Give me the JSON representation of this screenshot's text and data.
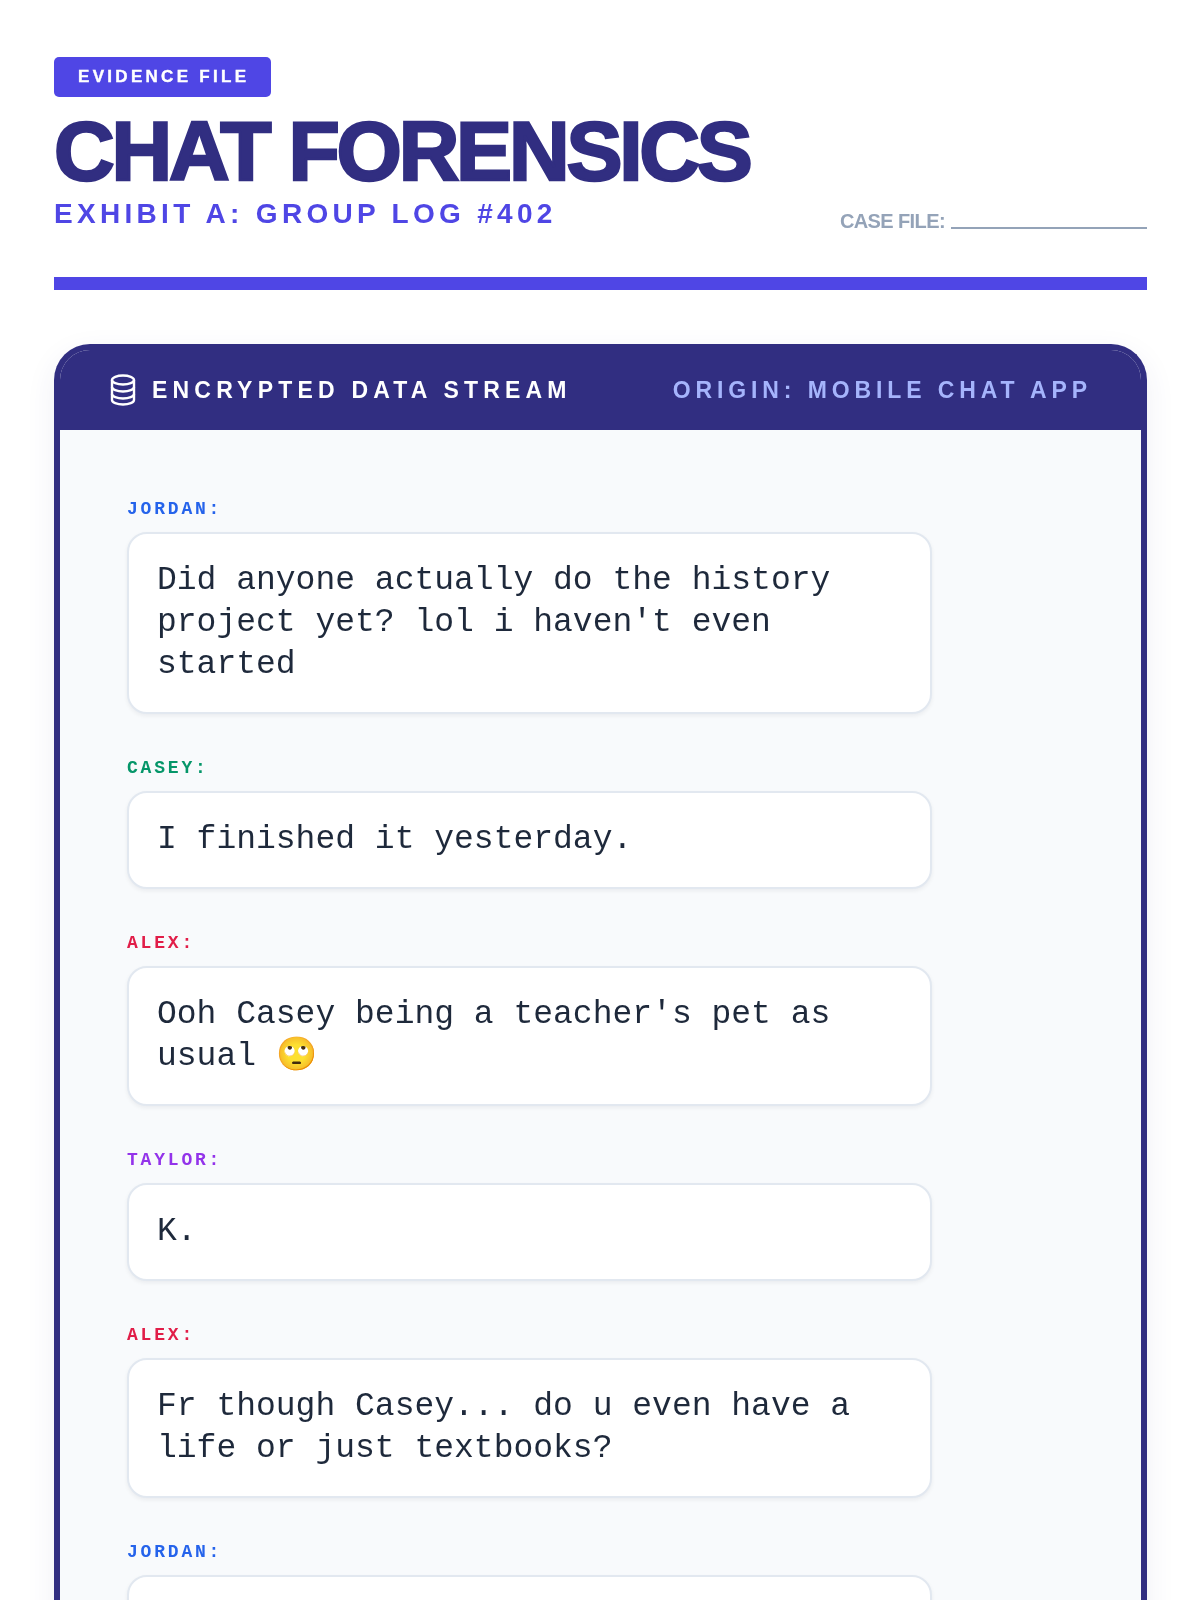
{
  "badge": "EVIDENCE FILE",
  "title": "CHAT FORENSICS",
  "subtitle": "EXHIBIT A: GROUP LOG #402",
  "case_file": {
    "label": "CASE FILE:"
  },
  "stream": {
    "title": "ENCRYPTED DATA STREAM",
    "origin": "ORIGIN: MOBILE CHAT APP"
  },
  "messages": [
    {
      "sender": "JORDAN:",
      "color": "#2563eb",
      "text": "Did anyone actually do the history project yet? lol i haven't even started"
    },
    {
      "sender": "CASEY:",
      "color": "#059669",
      "text": "I finished it yesterday."
    },
    {
      "sender": "ALEX:",
      "color": "#e11d48",
      "text": "Ooh Casey being a teacher's pet as usual 🙄"
    },
    {
      "sender": "TAYLOR:",
      "color": "#9333ea",
      "text": "K."
    },
    {
      "sender": "ALEX:",
      "color": "#e11d48",
      "text": "Fr though Casey... do u even have a life or just textbooks?"
    },
    {
      "sender": "JORDAN:",
      "color": "#2563eb"
    }
  ]
}
